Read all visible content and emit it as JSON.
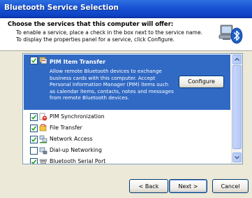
{
  "window": {
    "title": "Bluetooth Service Selection"
  },
  "header": {
    "title": "Choose the services that this computer will offer:",
    "line1": "To enable a service, place a check in the box next to the service name.",
    "line2": "To display the properties panel for a service, click Configure.",
    "logo_icon": "bluetooth-computer-icon"
  },
  "services": {
    "selected": {
      "label": "PIM Item Transfer",
      "checked": true,
      "icon": "pim-item-transfer-icon",
      "description": "Allow remote Bluetooth devices to exchange business cards with this computer. Accept Personal Information Manager (PIM) items such as calendar items, contacts, notes and messages from remote Bluetooth devices.",
      "configure_label": "Configure"
    },
    "items": [
      {
        "label": "PIM Synchronization",
        "checked": true,
        "icon": "pim-sync-icon"
      },
      {
        "label": "File Transfer",
        "checked": true,
        "icon": "file-transfer-icon"
      },
      {
        "label": "Network Access",
        "checked": true,
        "icon": "network-access-icon"
      },
      {
        "label": "Dial-up Networking",
        "checked": false,
        "icon": "dialup-networking-icon"
      },
      {
        "label": "Bluetooth Serial Port",
        "checked": true,
        "icon": "serial-port-icon"
      }
    ]
  },
  "buttons": {
    "back": "< Back",
    "next": "Next >",
    "cancel": "Cancel"
  },
  "colors": {
    "titlebar": "#0f44c6",
    "selection": "#316ac5",
    "dialog": "#ece9d8"
  }
}
